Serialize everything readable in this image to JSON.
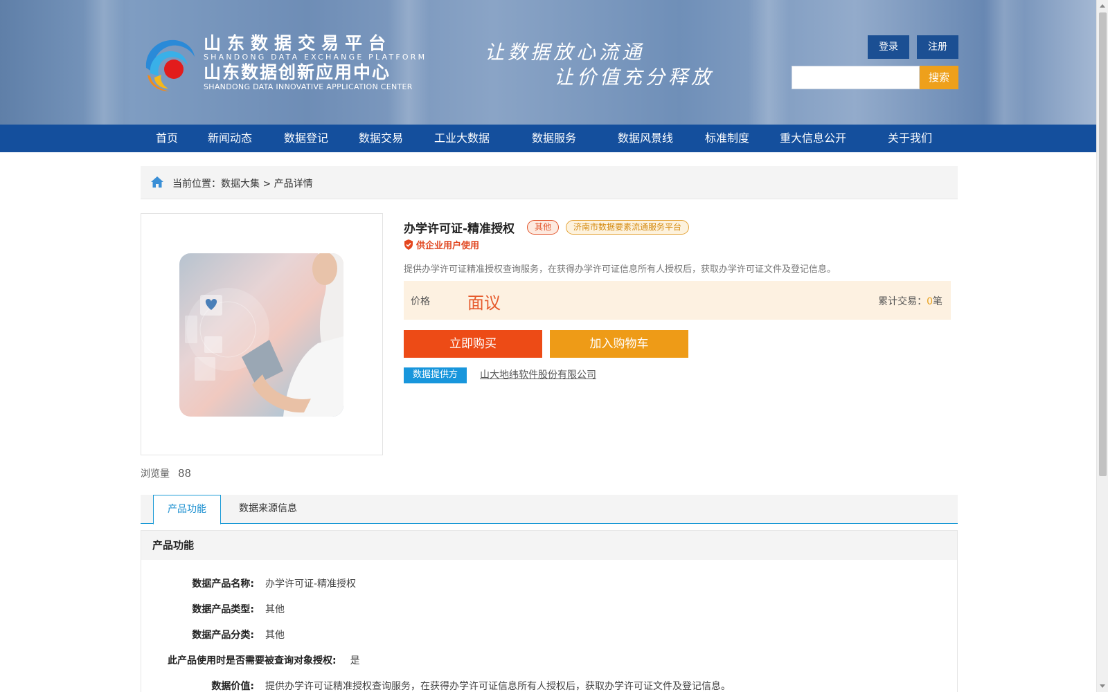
{
  "header": {
    "brand": {
      "cn_line1": "山东数据交易平台",
      "en_line1": "SHANDONG DATA EXCHANGE PLATFORM",
      "cn_line2": "山东数据创新应用中心",
      "en_line2": "SHANDONG DATA INNOVATIVE APPLICATION CENTER"
    },
    "slogan_line1": "让数据放心流通",
    "slogan_line2": "让价值充分释放",
    "login_label": "登录",
    "register_label": "注册",
    "search_placeholder": "",
    "search_label": "搜索"
  },
  "nav": {
    "items": [
      "首页",
      "新闻动态",
      "数据登记",
      "数据交易",
      "工业大数据",
      "数据服务",
      "数据风景线",
      "标准制度",
      "重大信息公开",
      "关于我们"
    ]
  },
  "breadcrumb": {
    "text": "当前位置：数据大集 > 产品详情"
  },
  "product": {
    "title": "办学许可证-精准授权",
    "tag_category": "其他",
    "tag_platform": "济南市数据要素流通服务平台",
    "enterprise_only": "供企业用户使用",
    "description": "提供办学许可证精准授权查询服务，在获得办学许可证信息所有人授权后，获取办学许可证文件及登记信息。",
    "price_label": "价格",
    "price_value": "面议",
    "deal_label": "累计交易：",
    "deal_count": "0",
    "deal_unit": "笔",
    "buy_label": "立即购买",
    "cart_label": "加入购物车",
    "provider_tag": "数据提供方",
    "provider_name": "山大地纬软件股份有限公司",
    "views_label": "浏览量",
    "views_count": "88"
  },
  "tabs": {
    "items": [
      "产品功能",
      "数据来源信息"
    ],
    "active": "产品功能"
  },
  "detail": {
    "heading": "产品功能",
    "rows": [
      {
        "key": "数据产品名称:",
        "value": "办学许可证-精准授权"
      },
      {
        "key": "数据产品类型:",
        "value": "其他"
      },
      {
        "key": "数据产品分类:",
        "value": "其他"
      },
      {
        "key": "此产品使用时是否需要被查询对象授权:",
        "value": "是"
      },
      {
        "key": "数据价值:",
        "value": "提供办学许可证精准授权查询服务，在获得办学许可证信息所有人授权后，获取办学许可证文件及登记信息。"
      }
    ]
  },
  "colors": {
    "nav_bg": "#144f9d",
    "accent_orange": "#ee9b17",
    "buy_red": "#ed4b16",
    "tab_blue": "#1a9ad6"
  }
}
